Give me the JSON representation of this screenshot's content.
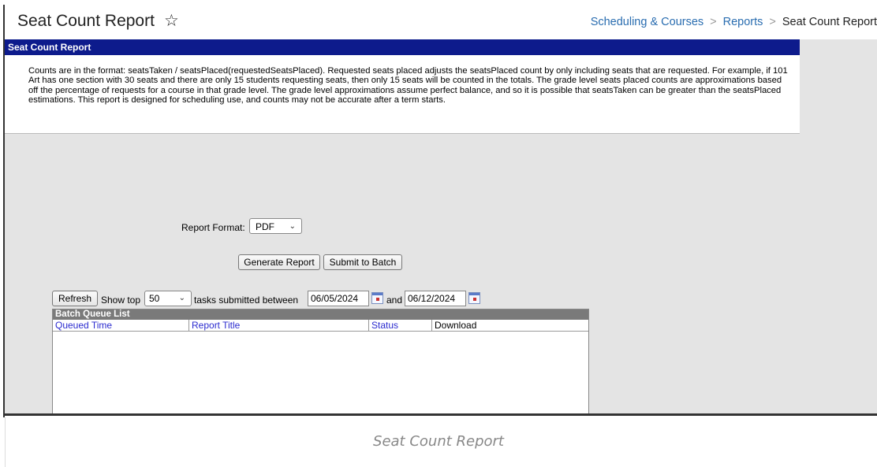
{
  "header": {
    "title": "Seat Count Report",
    "breadcrumb": [
      "Scheduling & Courses",
      "Reports",
      "Seat Count Report"
    ]
  },
  "panel": {
    "title": "Seat Count Report",
    "description": "Counts are in the format: seatsTaken / seatsPlaced(requestedSeatsPlaced). Requested seats placed adjusts the seatsPlaced count by only including seats that are requested. For example, if 101 Art has one section with 30 seats and there are only 15 students requesting seats, then only 15 seats will be counted in the totals. The grade level seats placed counts are approximations based off the percentage of requests for a course in that grade level. The grade level approximations assume perfect balance, and so it is possible that seatsTaken can be greater than the seatsPlaced estimations. This report is designed for scheduling use, and counts may not be accurate after a term starts."
  },
  "form": {
    "report_format_label": "Report Format:",
    "report_format_value": "PDF",
    "generate_button": "Generate Report",
    "submit_button": "Submit to Batch"
  },
  "batch": {
    "refresh_button": "Refresh",
    "show_top_label": "Show top",
    "show_top_value": "50",
    "tasks_label": "tasks submitted between",
    "start_date": "06/05/2024",
    "and_label": "and",
    "end_date": "06/12/2024",
    "queue_title": "Batch Queue List",
    "columns": [
      "Queued Time",
      "Report Title",
      "Status",
      "Download"
    ]
  },
  "caption": "Seat Count Report",
  "colors": {
    "panel_title_bg": "#0d1b8c",
    "link": "#2a6db0",
    "column_link": "#2b2bcf",
    "gray_bg": "#e4e4e4"
  }
}
